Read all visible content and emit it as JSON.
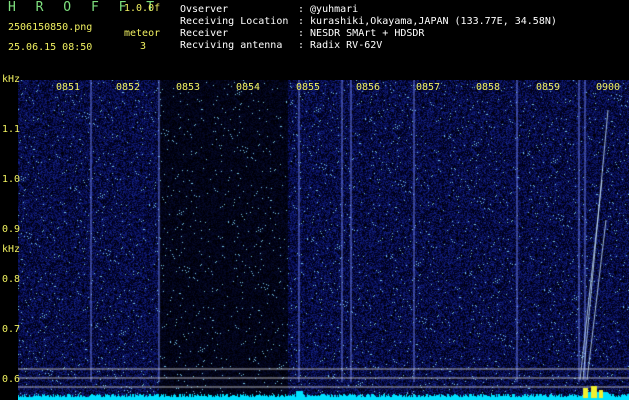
{
  "app": {
    "title": "H R O F F T",
    "version": "1.0.0f"
  },
  "file": {
    "name": "2506150850.png",
    "datetime": "25.06.15 08:50"
  },
  "meteor": {
    "label": "meteor",
    "count": "3"
  },
  "info": [
    {
      "label": "Ovserver",
      "value": ": @yuhmari"
    },
    {
      "label": "Receiving Location",
      "value": ": kurashiki,Okayama,JAPAN (133.77E, 34.58N)"
    },
    {
      "label": "Receiver",
      "value": ": NESDR SMArt + HDSDR"
    },
    {
      "label": "Recviving antenna",
      "value": ": Radix RV-62V"
    }
  ],
  "axis": {
    "unit_top": "kHz",
    "unit_mid": "kHz",
    "freq_ticks": [
      "1.1",
      "1.0",
      "0.9",
      "0.8",
      "0.7",
      "0.6"
    ],
    "time_ticks": [
      "0851",
      "0852",
      "0853",
      "0854",
      "0855",
      "0856",
      "0857",
      "0858",
      "0859",
      "0900"
    ]
  },
  "colors": {
    "accent_green": "#7ee07e",
    "label_yellow": "#f0f060",
    "spectrum_cyan": "#00e0ff",
    "noise_blue": "#1a2aa0"
  }
}
